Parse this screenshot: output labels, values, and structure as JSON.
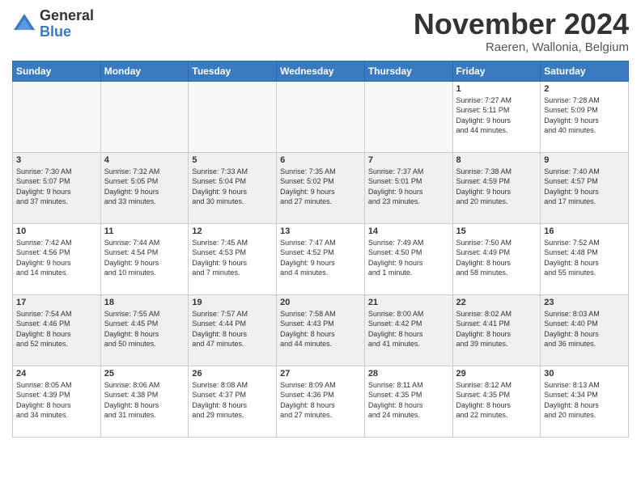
{
  "logo": {
    "general": "General",
    "blue": "Blue"
  },
  "title": "November 2024",
  "location": "Raeren, Wallonia, Belgium",
  "days_of_week": [
    "Sunday",
    "Monday",
    "Tuesday",
    "Wednesday",
    "Thursday",
    "Friday",
    "Saturday"
  ],
  "weeks": [
    [
      {
        "day": "",
        "info": ""
      },
      {
        "day": "",
        "info": ""
      },
      {
        "day": "",
        "info": ""
      },
      {
        "day": "",
        "info": ""
      },
      {
        "day": "",
        "info": ""
      },
      {
        "day": "1",
        "info": "Sunrise: 7:27 AM\nSunset: 5:11 PM\nDaylight: 9 hours\nand 44 minutes."
      },
      {
        "day": "2",
        "info": "Sunrise: 7:28 AM\nSunset: 5:09 PM\nDaylight: 9 hours\nand 40 minutes."
      }
    ],
    [
      {
        "day": "3",
        "info": "Sunrise: 7:30 AM\nSunset: 5:07 PM\nDaylight: 9 hours\nand 37 minutes."
      },
      {
        "day": "4",
        "info": "Sunrise: 7:32 AM\nSunset: 5:05 PM\nDaylight: 9 hours\nand 33 minutes."
      },
      {
        "day": "5",
        "info": "Sunrise: 7:33 AM\nSunset: 5:04 PM\nDaylight: 9 hours\nand 30 minutes."
      },
      {
        "day": "6",
        "info": "Sunrise: 7:35 AM\nSunset: 5:02 PM\nDaylight: 9 hours\nand 27 minutes."
      },
      {
        "day": "7",
        "info": "Sunrise: 7:37 AM\nSunset: 5:01 PM\nDaylight: 9 hours\nand 23 minutes."
      },
      {
        "day": "8",
        "info": "Sunrise: 7:38 AM\nSunset: 4:59 PM\nDaylight: 9 hours\nand 20 minutes."
      },
      {
        "day": "9",
        "info": "Sunrise: 7:40 AM\nSunset: 4:57 PM\nDaylight: 9 hours\nand 17 minutes."
      }
    ],
    [
      {
        "day": "10",
        "info": "Sunrise: 7:42 AM\nSunset: 4:56 PM\nDaylight: 9 hours\nand 14 minutes."
      },
      {
        "day": "11",
        "info": "Sunrise: 7:44 AM\nSunset: 4:54 PM\nDaylight: 9 hours\nand 10 minutes."
      },
      {
        "day": "12",
        "info": "Sunrise: 7:45 AM\nSunset: 4:53 PM\nDaylight: 9 hours\nand 7 minutes."
      },
      {
        "day": "13",
        "info": "Sunrise: 7:47 AM\nSunset: 4:52 PM\nDaylight: 9 hours\nand 4 minutes."
      },
      {
        "day": "14",
        "info": "Sunrise: 7:49 AM\nSunset: 4:50 PM\nDaylight: 9 hours\nand 1 minute."
      },
      {
        "day": "15",
        "info": "Sunrise: 7:50 AM\nSunset: 4:49 PM\nDaylight: 8 hours\nand 58 minutes."
      },
      {
        "day": "16",
        "info": "Sunrise: 7:52 AM\nSunset: 4:48 PM\nDaylight: 8 hours\nand 55 minutes."
      }
    ],
    [
      {
        "day": "17",
        "info": "Sunrise: 7:54 AM\nSunset: 4:46 PM\nDaylight: 8 hours\nand 52 minutes."
      },
      {
        "day": "18",
        "info": "Sunrise: 7:55 AM\nSunset: 4:45 PM\nDaylight: 8 hours\nand 50 minutes."
      },
      {
        "day": "19",
        "info": "Sunrise: 7:57 AM\nSunset: 4:44 PM\nDaylight: 8 hours\nand 47 minutes."
      },
      {
        "day": "20",
        "info": "Sunrise: 7:58 AM\nSunset: 4:43 PM\nDaylight: 8 hours\nand 44 minutes."
      },
      {
        "day": "21",
        "info": "Sunrise: 8:00 AM\nSunset: 4:42 PM\nDaylight: 8 hours\nand 41 minutes."
      },
      {
        "day": "22",
        "info": "Sunrise: 8:02 AM\nSunset: 4:41 PM\nDaylight: 8 hours\nand 39 minutes."
      },
      {
        "day": "23",
        "info": "Sunrise: 8:03 AM\nSunset: 4:40 PM\nDaylight: 8 hours\nand 36 minutes."
      }
    ],
    [
      {
        "day": "24",
        "info": "Sunrise: 8:05 AM\nSunset: 4:39 PM\nDaylight: 8 hours\nand 34 minutes."
      },
      {
        "day": "25",
        "info": "Sunrise: 8:06 AM\nSunset: 4:38 PM\nDaylight: 8 hours\nand 31 minutes."
      },
      {
        "day": "26",
        "info": "Sunrise: 8:08 AM\nSunset: 4:37 PM\nDaylight: 8 hours\nand 29 minutes."
      },
      {
        "day": "27",
        "info": "Sunrise: 8:09 AM\nSunset: 4:36 PM\nDaylight: 8 hours\nand 27 minutes."
      },
      {
        "day": "28",
        "info": "Sunrise: 8:11 AM\nSunset: 4:35 PM\nDaylight: 8 hours\nand 24 minutes."
      },
      {
        "day": "29",
        "info": "Sunrise: 8:12 AM\nSunset: 4:35 PM\nDaylight: 8 hours\nand 22 minutes."
      },
      {
        "day": "30",
        "info": "Sunrise: 8:13 AM\nSunset: 4:34 PM\nDaylight: 8 hours\nand 20 minutes."
      }
    ]
  ]
}
